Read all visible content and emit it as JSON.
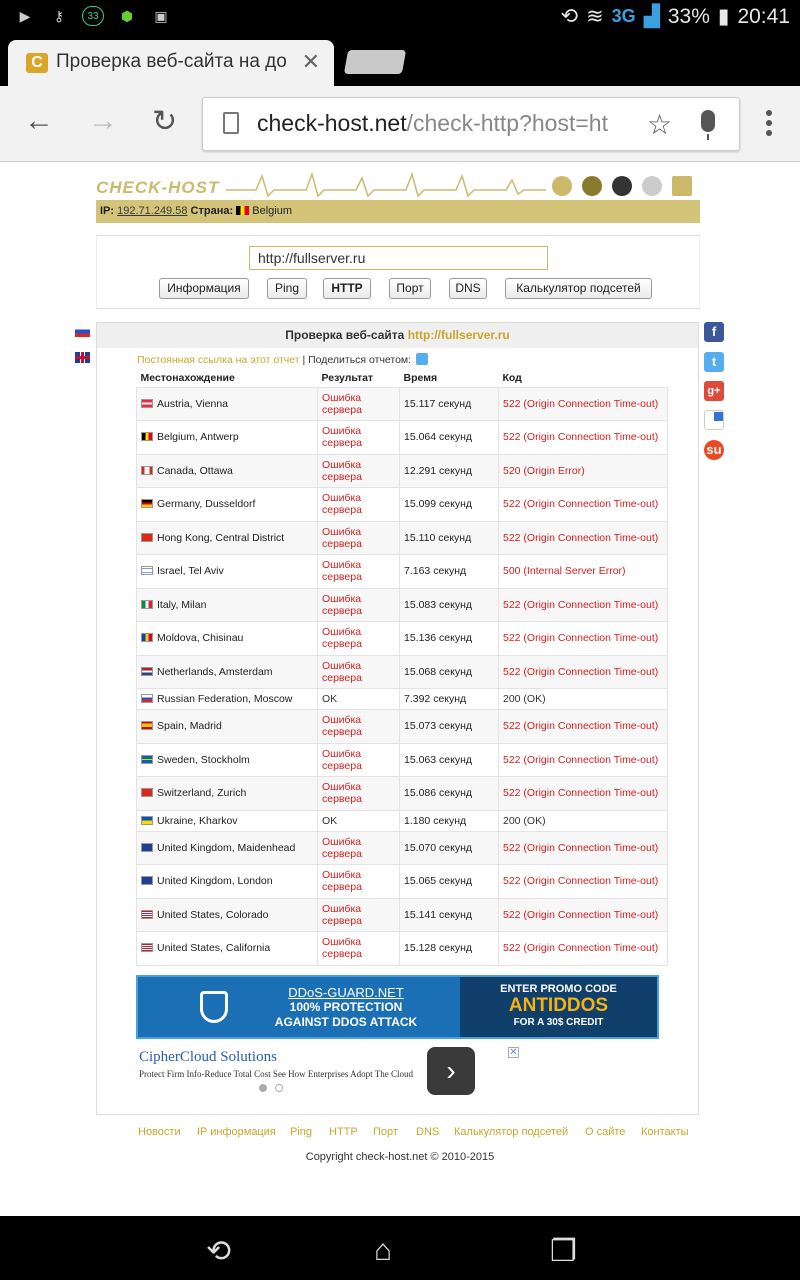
{
  "status_bar": {
    "network": "3G",
    "battery": "33%",
    "time": "20:41",
    "notification_badge": "33"
  },
  "tab": {
    "title": "Проверка веб-сайта на до",
    "favicon": "C"
  },
  "toolbar": {
    "url_host": "check-host.net",
    "url_path": "/check-http?host=ht"
  },
  "site": {
    "logo": "CHECK-HOST",
    "ip_label": "IP:",
    "ip_value": "192.71.249.58",
    "country_label": "Страна:",
    "country_value": "Belgium"
  },
  "form": {
    "host_value": "http://fullserver.ru",
    "buttons": [
      "Информация",
      "Ping",
      "HTTP",
      "Порт",
      "DNS",
      "Калькулятор подсетей"
    ]
  },
  "report": {
    "title_prefix": "Проверка веб-сайта",
    "title_host": "http://fullserver.ru",
    "permalink": "Постоянная ссылка на этот отчет",
    "separator": "|",
    "share_label": "Поделиться отчетом:",
    "columns": [
      "Местонахождение",
      "Результат",
      "Время",
      "Код"
    ],
    "rows": [
      {
        "location": "Austria, Vienna",
        "result": "Ошибка сервера",
        "time": "15.117 секунд",
        "code": "522 (Origin Connection Time-out)"
      },
      {
        "location": "Belgium, Antwerp",
        "result": "Ошибка сервера",
        "time": "15.064 секунд",
        "code": "522 (Origin Connection Time-out)"
      },
      {
        "location": "Canada, Ottawa",
        "result": "Ошибка сервера",
        "time": "12.291 секунд",
        "code": "520 (Origin Error)"
      },
      {
        "location": "Germany, Dusseldorf",
        "result": "Ошибка сервера",
        "time": "15.099 секунд",
        "code": "522 (Origin Connection Time-out)"
      },
      {
        "location": "Hong Kong, Central District",
        "result": "Ошибка сервера",
        "time": "15.110 секунд",
        "code": "522 (Origin Connection Time-out)"
      },
      {
        "location": "Israel, Tel Aviv",
        "result": "Ошибка сервера",
        "time": "7.163 секунд",
        "code": "500 (Internal Server Error)"
      },
      {
        "location": "Italy, Milan",
        "result": "Ошибка сервера",
        "time": "15.083 секунд",
        "code": "522 (Origin Connection Time-out)"
      },
      {
        "location": "Moldova, Chisinau",
        "result": "Ошибка сервера",
        "time": "15.136 секунд",
        "code": "522 (Origin Connection Time-out)"
      },
      {
        "location": "Netherlands, Amsterdam",
        "result": "Ошибка сервера",
        "time": "15.068 секунд",
        "code": "522 (Origin Connection Time-out)"
      },
      {
        "location": "Russian Federation, Moscow",
        "result": "OK",
        "time": "7.392 секунд",
        "code": "200 (OK)"
      },
      {
        "location": "Spain, Madrid",
        "result": "Ошибка сервера",
        "time": "15.073 секунд",
        "code": "522 (Origin Connection Time-out)"
      },
      {
        "location": "Sweden, Stockholm",
        "result": "Ошибка сервера",
        "time": "15.063 секунд",
        "code": "522 (Origin Connection Time-out)"
      },
      {
        "location": "Switzerland, Zurich",
        "result": "Ошибка сервера",
        "time": "15.086 секунд",
        "code": "522 (Origin Connection Time-out)"
      },
      {
        "location": "Ukraine, Kharkov",
        "result": "OK",
        "time": "1.180 секунд",
        "code": "200 (OK)"
      },
      {
        "location": "United Kingdom, Maidenhead",
        "result": "Ошибка сервера",
        "time": "15.070 секунд",
        "code": "522 (Origin Connection Time-out)"
      },
      {
        "location": "United Kingdom, London",
        "result": "Ошибка сервера",
        "time": "15.065 секунд",
        "code": "522 (Origin Connection Time-out)"
      },
      {
        "location": "United States, Colorado",
        "result": "Ошибка сервера",
        "time": "15.141 секунд",
        "code": "522 (Origin Connection Time-out)"
      },
      {
        "location": "United States, California",
        "result": "Ошибка сервера",
        "time": "15.128 секунд",
        "code": "522 (Origin Connection Time-out)"
      }
    ]
  },
  "ads": {
    "banner_brand": "DDoS-GUARD.NET",
    "banner_line2": "100% PROTECTION",
    "banner_line3": "AGAINST DDOS ATTACK",
    "banner_promo1": "ENTER PROMO CODE",
    "banner_promo2": "ANTIDDOS",
    "banner_promo3": "FOR A 30$ CREDIT",
    "cc_title": "CipherCloud Solutions",
    "cc_desc": "Protect Firm Info-Reduce Total Cost See How Enterprises Adopt The Cloud"
  },
  "footer": {
    "links": [
      "Новости",
      "IP информация",
      "Ping",
      "HTTP",
      "Порт",
      "DNS",
      "Калькулятор подсетей",
      "О сайте",
      "Контакты"
    ],
    "copyright": "Copyright check-host.net © 2010-2015"
  },
  "colors": {
    "accent_gold": "#c9a629",
    "ip_bar": "#d3c47a",
    "error_red": "#d42020"
  }
}
